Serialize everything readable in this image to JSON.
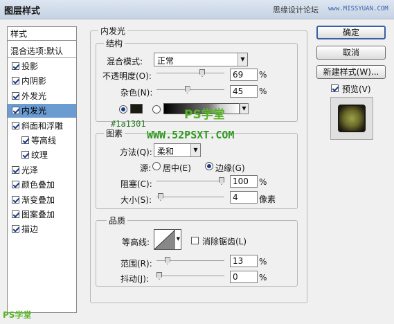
{
  "window": {
    "title": "图层样式",
    "watermark_cn": "思缘设计论坛",
    "watermark_url": "www.MISSYUAN.COM"
  },
  "left_panel": {
    "header": "样式",
    "blend": "混合选项:默认",
    "items": [
      {
        "label": "投影",
        "checked": true
      },
      {
        "label": "内阴影",
        "checked": true
      },
      {
        "label": "外发光",
        "checked": true
      },
      {
        "label": "内发光",
        "checked": true,
        "selected": true
      },
      {
        "label": "斜面和浮雕",
        "checked": true
      },
      {
        "label": "等高线",
        "checked": true,
        "indent": true
      },
      {
        "label": "纹理",
        "checked": true,
        "indent": true
      },
      {
        "label": "光泽",
        "checked": true
      },
      {
        "label": "颜色叠加",
        "checked": true
      },
      {
        "label": "渐变叠加",
        "checked": true
      },
      {
        "label": "图案叠加",
        "checked": true
      },
      {
        "label": "描边",
        "checked": true
      }
    ]
  },
  "inner_glow": {
    "title": "内发光",
    "structure": {
      "title": "结构",
      "blend_mode_label": "混合模式:",
      "blend_mode_value": "正常",
      "opacity_label": "不透明度(O):",
      "opacity_value": "69",
      "opacity_unit": "%",
      "opacity_level": 0.69,
      "noise_label": "杂色(N):",
      "noise_value": "45",
      "noise_unit": "%",
      "noise_level": 0.45,
      "color": "#1a1a10"
    },
    "elements": {
      "title": "图素",
      "method_label": "方法(Q):",
      "method_value": "柔和",
      "source_label": "源:",
      "source_center": "居中(E)",
      "source_edge": "边缘(G)",
      "choke_label": "阻塞(C):",
      "choke_value": "100",
      "choke_unit": "%",
      "choke_level": 1.0,
      "size_label": "大小(S):",
      "size_value": "4",
      "size_unit": "像素",
      "size_level": 0.02
    },
    "quality": {
      "title": "品质",
      "contour_label": "等高线:",
      "antialias_label": "消除锯齿(L)",
      "range_label": "范围(R):",
      "range_value": "13",
      "range_unit": "%",
      "range_level": 0.13,
      "jitter_label": "抖动(J):",
      "jitter_value": "0",
      "jitter_unit": "%",
      "jitter_level": 0.0
    }
  },
  "buttons": {
    "ok": "确定",
    "cancel": "取消",
    "new_style": "新建样式(W)...",
    "preview": "预览(V)"
  },
  "watermarks": {
    "ps": "PS学堂",
    "hex": "#1a1301",
    "url": "WWW.52PSXT.COM",
    "bottom": "PS学堂"
  }
}
